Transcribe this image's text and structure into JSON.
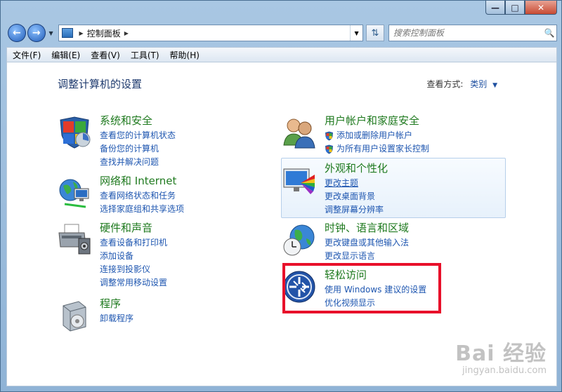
{
  "window": {
    "caption_buttons": {
      "minimize": "—",
      "maximize": "□",
      "close": "✕"
    }
  },
  "nav": {
    "back_icon": "back-arrow-icon",
    "forward_icon": "forward-arrow-icon",
    "address_path": "控制面板",
    "search_placeholder": "搜索控制面板"
  },
  "menu": [
    "文件(F)",
    "编辑(E)",
    "查看(V)",
    "工具(T)",
    "帮助(H)"
  ],
  "main": {
    "title": "调整计算机的设置",
    "view_by_label": "查看方式:",
    "view_by_value": "类别"
  },
  "categories": {
    "system": {
      "title": "系统和安全",
      "links": [
        "查看您的计算机状态",
        "备份您的计算机",
        "查找并解决问题"
      ]
    },
    "network": {
      "title": "网络和 Internet",
      "links": [
        "查看网络状态和任务",
        "选择家庭组和共享选项"
      ]
    },
    "hardware": {
      "title": "硬件和声音",
      "links": [
        "查看设备和打印机",
        "添加设备",
        "连接到投影仪",
        "调整常用移动设置"
      ]
    },
    "programs": {
      "title": "程序",
      "links": [
        "卸载程序"
      ]
    },
    "users": {
      "title": "用户帐户和家庭安全",
      "links": [
        "添加或删除用户帐户",
        "为所有用户设置家长控制"
      ]
    },
    "appearance": {
      "title": "外观和个性化",
      "links": [
        "更改主题",
        "更改桌面背景",
        "调整屏幕分辨率"
      ]
    },
    "clock": {
      "title": "时钟、语言和区域",
      "links": [
        "更改键盘或其他输入法",
        "更改显示语言"
      ]
    },
    "ease": {
      "title": "轻松访问",
      "links": [
        "使用 Windows 建议的设置",
        "优化视频显示"
      ]
    }
  },
  "watermark": {
    "main": "Bai 经验",
    "sub": "jingyan.baidu.com"
  }
}
